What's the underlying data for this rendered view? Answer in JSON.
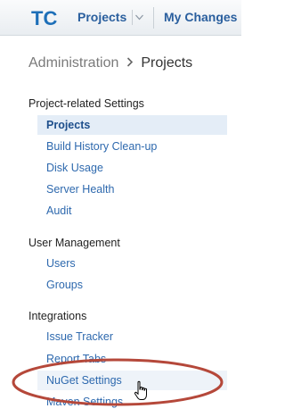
{
  "header": {
    "logo_text": "TC",
    "projects_label": "Projects",
    "my_changes_label": "My Changes"
  },
  "breadcrumb": {
    "parent": "Administration",
    "current": "Projects"
  },
  "groups": [
    {
      "title": "Project-related Settings",
      "items": [
        {
          "label": "Projects",
          "selected": true
        },
        {
          "label": "Build History Clean-up"
        },
        {
          "label": "Disk Usage"
        },
        {
          "label": "Server Health"
        },
        {
          "label": "Audit"
        }
      ]
    },
    {
      "title": "User Management",
      "items": [
        {
          "label": "Users"
        },
        {
          "label": "Groups"
        }
      ]
    },
    {
      "title": "Integrations",
      "items": [
        {
          "label": "Issue Tracker"
        },
        {
          "label": "Report Tabs"
        },
        {
          "label": "NuGet Settings",
          "hovered": true
        },
        {
          "label": "Maven Settings"
        }
      ]
    }
  ],
  "colors": {
    "link": "#2e69ae",
    "selected_bg": "#e4edf7",
    "annotation_ellipse": "#b5483a"
  },
  "icons": {
    "logo": "teamcity-logo-icon",
    "dropdown": "chevron-down-icon",
    "breadcrumb_separator": "chevron-right-icon",
    "cursor": "hand-pointer-icon"
  }
}
